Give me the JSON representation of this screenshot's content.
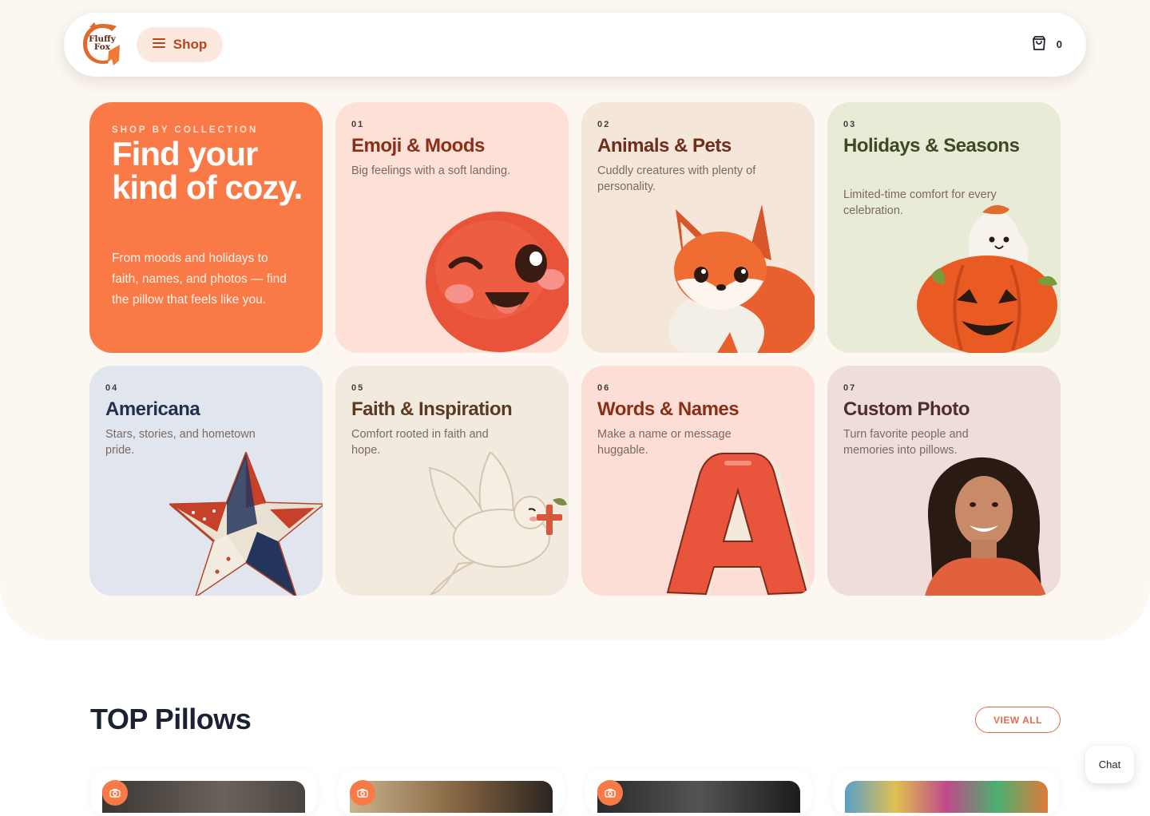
{
  "header": {
    "logo_text_1": "Fluffy",
    "logo_text_2": "Fox",
    "shop_label": "Shop",
    "cart_count": "0"
  },
  "intro": {
    "eyebrow": "SHOP BY COLLECTION",
    "headline": "Find your kind of cozy.",
    "body": "From moods and holidays to faith, names, and photos — find the pillow that feels like you."
  },
  "collections": [
    {
      "num": "01",
      "title": "Emoji & Moods",
      "desc": "Big feelings with a soft landing.",
      "bg": "#fde0d6",
      "title_color": "#8a2f17"
    },
    {
      "num": "02",
      "title": "Animals & Pets",
      "desc": "Cuddly creatures with plenty of personality.",
      "bg": "#f4e7da",
      "title_color": "#6e2e1a"
    },
    {
      "num": "03",
      "title": "Holidays & Seasons",
      "desc": "Limited-time comfort for every celebration.",
      "bg": "#e8ebd6",
      "title_color": "#3e4a24"
    },
    {
      "num": "04",
      "title": "Americana",
      "desc": "Stars, stories, and hometown pride.",
      "bg": "#e1e6ee",
      "title_color": "#23304d"
    },
    {
      "num": "05",
      "title": "Faith & Inspiration",
      "desc": "Comfort rooted in faith and hope.",
      "bg": "#f2eadf",
      "title_color": "#5b3a22"
    },
    {
      "num": "06",
      "title": "Words & Names",
      "desc": "Make a name or message huggable.",
      "bg": "#fdded6",
      "title_color": "#8a2f17"
    },
    {
      "num": "07",
      "title": "Custom Photo",
      "desc": "Turn favorite people and memories into pillows.",
      "bg": "#eeddda",
      "title_color": "#4d3029"
    }
  ],
  "top_section": {
    "title": "TOP Pillows",
    "view_all": "VIEW ALL"
  },
  "chat_label": "Chat",
  "icons": {
    "shop": "menu-icon",
    "cart": "shopping-bag-icon",
    "product_badge": "camera-icon"
  },
  "colors": {
    "accent": "#fa7a47",
    "accent_dark": "#b6461d"
  }
}
